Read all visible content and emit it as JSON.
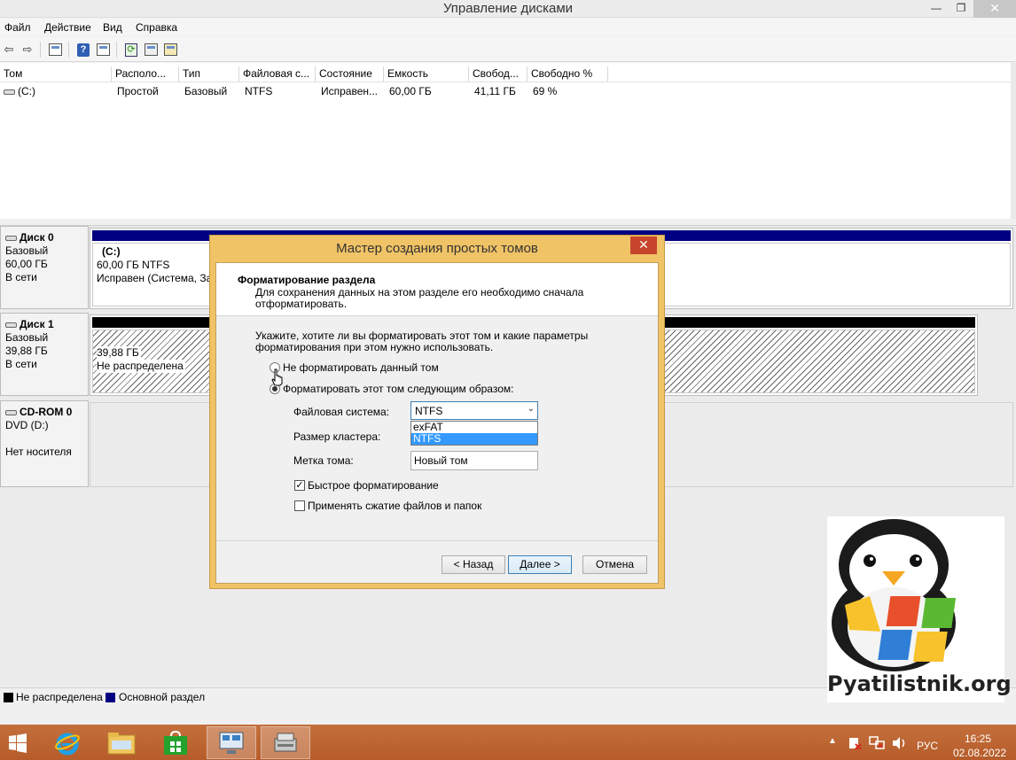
{
  "window": {
    "title": "Управление дисками",
    "minimize": "—",
    "restore": "❐",
    "close": "✕"
  },
  "menu": [
    "Файл",
    "Действие",
    "Вид",
    "Справка"
  ],
  "toolbar": {
    "back": "⇦",
    "forward": "⇨",
    "help": "?",
    "refresh": "⟳"
  },
  "volumes": {
    "columns": [
      "Том",
      "Располо...",
      "Тип",
      "Файловая с...",
      "Состояние",
      "Емкость",
      "Свобод...",
      "Свободно %"
    ],
    "rows": [
      {
        "volume": "(C:)",
        "layout": "Простой",
        "type": "Базовый",
        "fs": "NTFS",
        "status": "Исправен...",
        "capacity": "60,00 ГБ",
        "free": "41,11 ГБ",
        "free_pct": "69 %"
      }
    ]
  },
  "disks": [
    {
      "name": "Диск 0",
      "type": "Базовый",
      "size": "60,00 ГБ",
      "state": "В сети",
      "partition": {
        "title": "(C:)",
        "size": "60,00 ГБ NTFS",
        "status": "Исправен (Система, За"
      }
    },
    {
      "name": "Диск 1",
      "type": "Базовый",
      "size": "39,88 ГБ",
      "state": "В сети",
      "partition": {
        "size": "39,88 ГБ",
        "status": "Не распределена"
      }
    },
    {
      "name": "CD-ROM 0",
      "type": "DVD (D:)",
      "state": "Нет носителя"
    }
  ],
  "legend": [
    {
      "label": "Не распределена",
      "color": "#000000"
    },
    {
      "label": "Основной раздел",
      "color": "#000080"
    }
  ],
  "dialog": {
    "title": "Мастер создания простых томов",
    "close": "✕",
    "heading": "Форматирование раздела",
    "subheading": "Для сохранения данных на этом разделе его необходимо сначала отформатировать.",
    "intro": "Укажите, хотите ли вы форматировать этот том и какие параметры форматирования при этом нужно использовать.",
    "option_no_format": "Не форматировать данный том",
    "option_format": "Форматировать этот том следующим образом:",
    "fs_label": "Файловая система:",
    "fs_value": "NTFS",
    "fs_options": [
      "exFAT",
      "NTFS"
    ],
    "cluster_label": "Размер кластера:",
    "volume_label_label": "Метка тома:",
    "volume_label_value": "Новый том",
    "quick_format": "Быстрое форматирование",
    "quick_format_check": "✓",
    "compression": "Применять сжатие файлов и папок",
    "back_button": "< Назад",
    "next_button": "Далее >",
    "cancel_button": "Отмена"
  },
  "logo": {
    "text": "Pyatilistnik.org"
  },
  "taskbar": {
    "language": "РУС",
    "time": "16:25",
    "date": "02.08.2022"
  },
  "colors": {
    "primary_partition": "#000080",
    "unallocated": "#000000",
    "taskbar": "#b65c2a",
    "dialog_frame": "#f0c366"
  }
}
